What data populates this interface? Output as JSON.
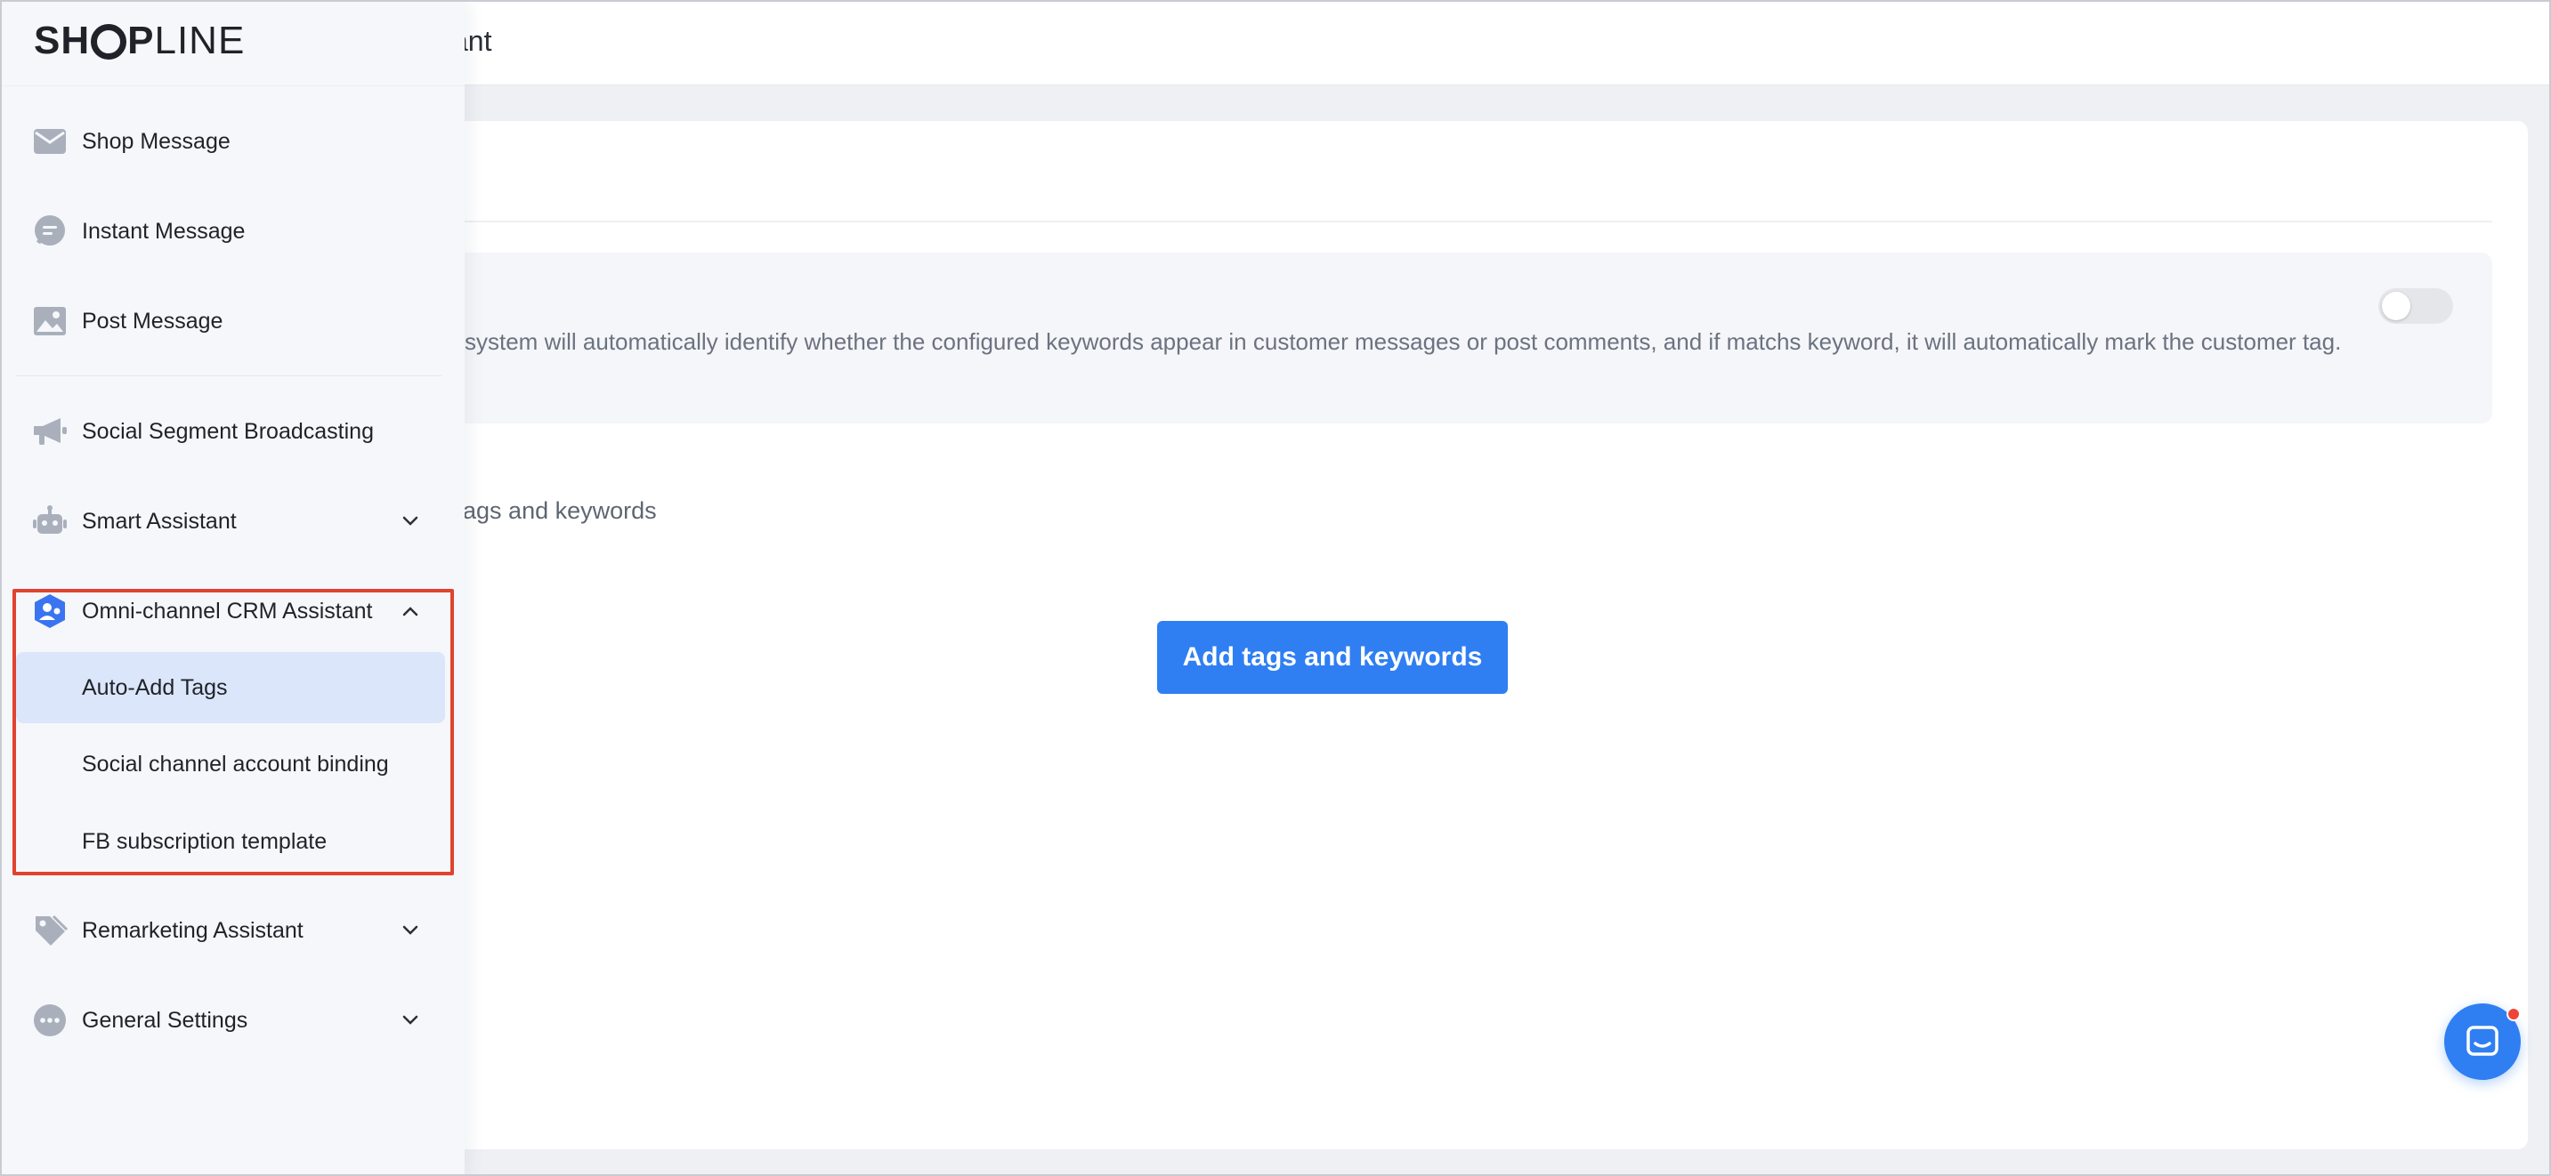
{
  "brand": {
    "text_bold": "SH",
    "text_bold_after": "P",
    "text_light": "LINE"
  },
  "header": {
    "title": "sistant"
  },
  "main": {
    "info_text": "system will automatically identify whether the configured keywords appear in customer messages or post comments, and if matchs keyword, it will automatically mark the customer tag.",
    "toggle_state": "off",
    "empty_label": "n tags and keywords",
    "add_button_label": "Add tags and keywords"
  },
  "sidebar": {
    "items": [
      {
        "label": "Shop Message",
        "icon": "envelope-icon"
      },
      {
        "label": "Instant Message",
        "icon": "chat-bubble-icon"
      },
      {
        "label": "Post Message",
        "icon": "image-icon"
      },
      {
        "label": "Social Segment Broadcasting",
        "icon": "megaphone-icon"
      },
      {
        "label": "Smart Assistant",
        "icon": "robot-icon"
      },
      {
        "label": "Omni-channel CRM Assistant",
        "icon": "crm-shield-icon"
      },
      {
        "label": "Remarketing Assistant",
        "icon": "tag-icon"
      },
      {
        "label": "General Settings",
        "icon": "more-dots-icon"
      }
    ],
    "crm_subitems": [
      {
        "label": "Auto-Add Tags",
        "active": true
      },
      {
        "label": "Social channel account binding",
        "active": false
      },
      {
        "label": "FB subscription template",
        "active": false
      }
    ]
  },
  "colors": {
    "accent": "#2f7ff2",
    "highlight_border": "#e0432f",
    "active_subitem_bg": "#dbe6fb",
    "icon_gray": "#a9b0bc",
    "notification_dot": "#f04438"
  }
}
